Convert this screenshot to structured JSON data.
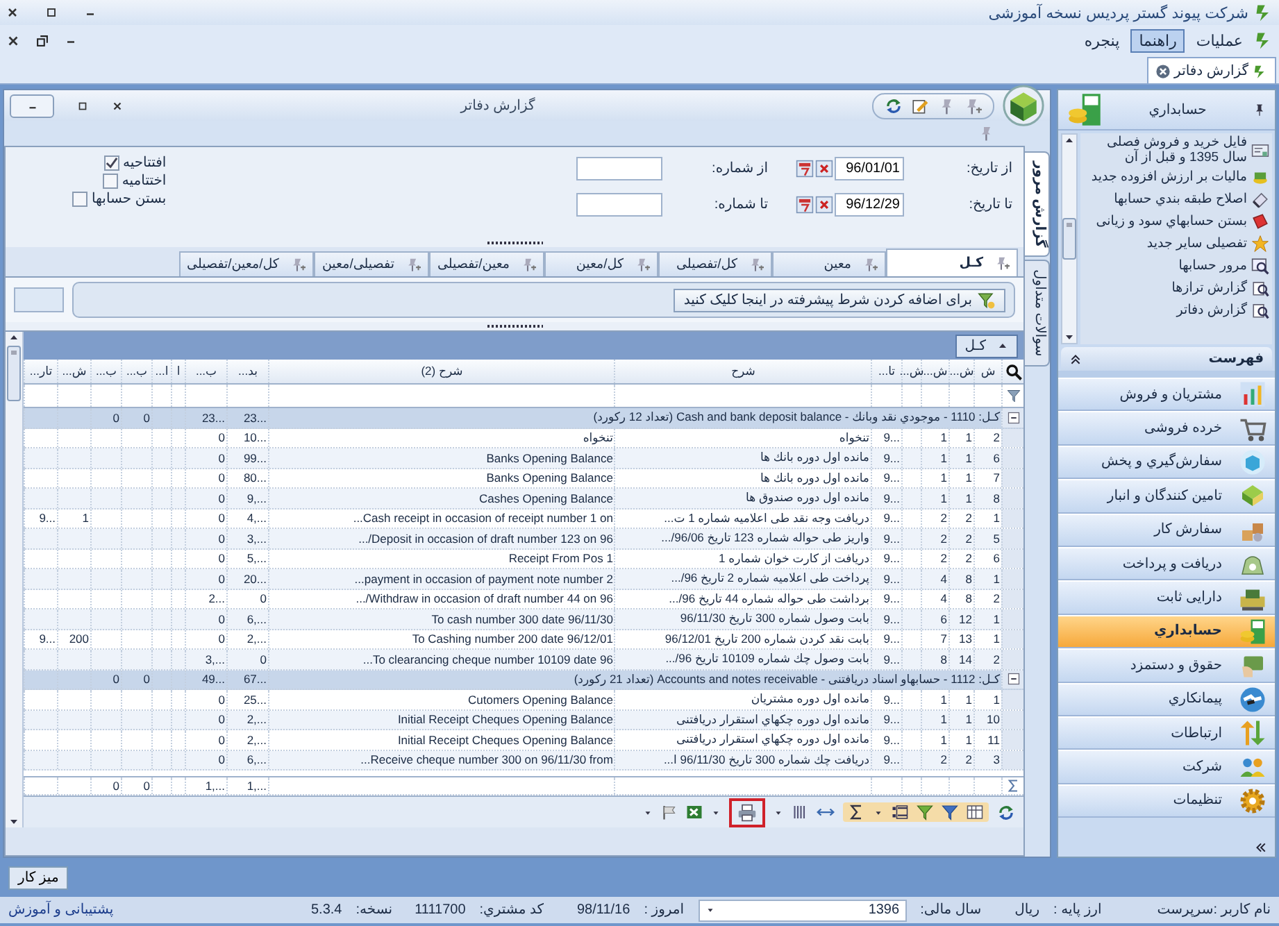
{
  "app": {
    "title": "شرکت پیوند گستر پردیس نسخه آموزشی"
  },
  "menu": [
    {
      "label": "عملیات",
      "selected": false
    },
    {
      "label": "راهنما",
      "selected": true
    },
    {
      "label": "پنجره",
      "selected": false
    }
  ],
  "doc_tabs": [
    {
      "label": "گزارش دفاتر",
      "selected": true
    }
  ],
  "report_window": {
    "title": "گزارش دفاتر",
    "side_tabs": [
      {
        "label": "گزارش مرور",
        "selected": true
      },
      {
        "label": "سوالات متداول",
        "selected": false
      }
    ],
    "date_filters": [
      {
        "label": "از تاریخ:",
        "value": "96/01/01"
      },
      {
        "label": "تا تاریخ:",
        "value": "96/12/29"
      }
    ],
    "number_filters": [
      {
        "label": "از شماره:"
      },
      {
        "label": "تا شماره:"
      }
    ],
    "options": [
      {
        "label": "افتتاحیه",
        "checked": true
      },
      {
        "label": "اختتامیه",
        "checked": false
      },
      {
        "label": "بستن حسابها",
        "checked": false
      }
    ],
    "level_tabs": [
      {
        "label": "کـل",
        "selected": true
      },
      {
        "label": "معین",
        "selected": false
      },
      {
        "label": "کل/تفصیلی",
        "selected": false
      },
      {
        "label": "کل/معین",
        "selected": false
      },
      {
        "label": "معین/تفصیلی",
        "selected": false
      },
      {
        "label": "تفصیلی/معین",
        "selected": false
      },
      {
        "label": "کل/معین/تفصیلی",
        "selected": false
      }
    ],
    "condition_hint": "برای اضافه کردن شرط پیشرفته در اینجا کلیک کنید",
    "group_by": "کـل",
    "grid": {
      "columns": [
        "ش",
        "ش...",
        "ش...",
        "ش...",
        "تا...",
        "شرح",
        "شرح (2)",
        "بد...",
        "ب...",
        "ا",
        "ا...",
        "ب...",
        "ب...",
        "ش...",
        "تار..."
      ],
      "groups": [
        {
          "label": "کـل:  1110 - موجودي نقد وبانك - Cash and bank deposit balance (تعداد 12 رکورد)",
          "expanded": true,
          "totals": {
            "column_8": "23...",
            "column_9": "23...",
            "column_12": "0",
            "column_13": "0"
          },
          "rows": [
            {
              "column_1": "2",
              "column_2": "1",
              "column_3": "1",
              "column_5": "9...",
              "column_6": "تنخواه",
              "column_7": "تنخواه",
              "column_8": "10...",
              "column_9": "0"
            },
            {
              "column_1": "6",
              "column_2": "1",
              "column_3": "1",
              "column_5": "9...",
              "column_6": "مانده اول دوره بانك ها",
              "column_7": "Banks  Opening Balance",
              "column_8": "99...",
              "column_9": "0"
            },
            {
              "column_1": "7",
              "column_2": "1",
              "column_3": "1",
              "column_5": "9...",
              "column_6": "مانده اول دوره بانك ها",
              "column_7": "Banks  Opening Balance",
              "column_8": "80...",
              "column_9": "0"
            },
            {
              "column_1": "8",
              "column_2": "1",
              "column_3": "1",
              "column_5": "9...",
              "column_6": "مانده اول دوره صندوق ها",
              "column_7": "Cashes  Opening Balance",
              "column_8": "9,...",
              "column_9": "0"
            },
            {
              "column_1": "1",
              "column_2": "2",
              "column_3": "2",
              "column_5": "9...",
              "column_6": "دریافت وجه نقد طی اعلامیه شماره 1 ت...",
              "column_7": "Cash receipt in occasion of receipt number 1 on...",
              "column_8": "4,...",
              "column_9": "0",
              "column_14": "1",
              "column_15": "9..."
            },
            {
              "column_1": "5",
              "column_2": "2",
              "column_3": "2",
              "column_5": "9...",
              "column_6": "واریز طی حواله شماره 123 تاریخ 96/06/...",
              "column_7": "Deposit in occasion of draft number 123 on 96/...",
              "column_8": "3,...",
              "column_9": "0"
            },
            {
              "column_1": "6",
              "column_2": "2",
              "column_3": "2",
              "column_5": "9...",
              "column_6": "دریافت از کارت خوان شماره 1",
              "column_7": "Receipt From Pos 1",
              "column_8": "5,...",
              "column_9": "0"
            },
            {
              "column_1": "1",
              "column_2": "8",
              "column_3": "4",
              "column_5": "9...",
              "column_6": "پرداخت طی اعلامیه شماره 2 تاریخ 96/...",
              "column_7": "payment in occasion of payment note number 2...",
              "column_8": "20...",
              "column_9": "0"
            },
            {
              "column_1": "2",
              "column_2": "8",
              "column_3": "4",
              "column_5": "9...",
              "column_6": "برداشت طی حواله شماره 44 تاریخ 96/...",
              "column_7": "Withdraw in occasion of draft number 44 on 96/...",
              "column_8": "0",
              "column_9": "2..."
            },
            {
              "column_1": "1",
              "column_2": "12",
              "column_3": "6",
              "column_5": "9...",
              "column_6": "بابت وصول شماره 300 تاریخ 96/11/30",
              "column_7": "To cash number 300 date 96/11/30",
              "column_8": "6,...",
              "column_9": "0"
            },
            {
              "column_1": "1",
              "column_2": "13",
              "column_3": "7",
              "column_5": "9...",
              "column_6": "بابت نقد کردن شماره 200 تاریخ 96/12/01",
              "column_7": "To Cashing number 200 date 96/12/01",
              "column_8": "2,...",
              "column_9": "0",
              "column_14": "200",
              "column_15": "9..."
            },
            {
              "column_1": "2",
              "column_2": "14",
              "column_3": "8",
              "column_5": "9...",
              "column_6": "بابت وصول چك شماره 10109 تاریخ 96/...",
              "column_7": "To clearancing cheque number 10109 date 96...",
              "column_8": "0",
              "column_9": "3,..."
            }
          ]
        },
        {
          "label": "کـل:  1112 - حسابهاو اسناد دریافتنی - Accounts and notes receivable (تعداد 21 رکورد)",
          "expanded": true,
          "totals": {
            "column_8": "67...",
            "column_9": "49...",
            "column_12": "0",
            "column_13": "0"
          },
          "rows": [
            {
              "column_1": "1",
              "column_2": "1",
              "column_3": "1",
              "column_5": "9...",
              "column_6": "مانده اول دوره مشتریان",
              "column_7": "Cutomers Opening Balance",
              "column_8": "25...",
              "column_9": "0"
            },
            {
              "column_1": "10",
              "column_2": "1",
              "column_3": "1",
              "column_5": "9...",
              "column_6": "مانده اول دوره چکهاي استقرار دریافتنی",
              "column_7": "Initial Receipt Cheques Opening Balance",
              "column_8": "2,...",
              "column_9": "0"
            },
            {
              "column_1": "11",
              "column_2": "1",
              "column_3": "1",
              "column_5": "9...",
              "column_6": "مانده اول دوره چکهاي استقرار دریافتنی",
              "column_7": "Initial Receipt Cheques Opening Balance",
              "column_8": "2,...",
              "column_9": "0"
            },
            {
              "column_1": "3",
              "column_2": "2",
              "column_3": "2",
              "column_5": "9...",
              "column_6": "دریافت چك شماره 300 تاریخ 96/11/30 ا...",
              "column_7": "Receive cheque number 300 on 96/11/30 from...",
              "column_8": "6,...",
              "column_9": "0"
            }
          ]
        }
      ],
      "summary": {
        "column_8": "1,...",
        "column_9": "1,...",
        "column_12": "0",
        "column_13": "0"
      }
    },
    "print_button": {
      "highlighted": true
    }
  },
  "sidebar": {
    "title": "حسابداري",
    "items": [
      "فایل خرید و فروش فصلی سال 1395 و قبل از آن",
      "مالیات بر ارزش افزوده جدید",
      "اصلاح طبقه بندي حسابها",
      "بستن حسابهاي سود و زیانی",
      "تفصیلی سایر جدید",
      "مرور حسابها",
      "گزارش ترازها",
      "گزارش دفاتر"
    ],
    "list_header": "فهرست",
    "modules": [
      {
        "label": "مشتریان و فروش",
        "selected": false
      },
      {
        "label": "خرده فروشی",
        "selected": false
      },
      {
        "label": "سفارش‌گیري و پخش",
        "selected": false
      },
      {
        "label": "تامین کنندگان و انبار",
        "selected": false
      },
      {
        "label": "سفارش کار",
        "selected": false
      },
      {
        "label": "دریافت و پرداخت",
        "selected": false
      },
      {
        "label": "دارایی ثابت",
        "selected": false
      },
      {
        "label": "حسابداري",
        "selected": true
      },
      {
        "label": "حقوق و دستمزد",
        "selected": false
      },
      {
        "label": "پیمانکاري",
        "selected": false
      },
      {
        "label": "ارتباطات",
        "selected": false
      },
      {
        "label": "شرکت",
        "selected": false
      },
      {
        "label": "تنظیمات",
        "selected": false
      }
    ]
  },
  "desk_button": "میز کار",
  "status": {
    "user": "نام کاربر :سرپرست",
    "base_currency_label": "ارز پایه :",
    "base_currency": "ریال",
    "fiscal_year_label": "سال مالی:",
    "fiscal_year": "1396",
    "today_label": "امروز :",
    "today": "98/11/16",
    "customer_code_label": "کد مشتري:",
    "customer_code": "1111700",
    "version_label": "نسخه:",
    "version": "5.3.4",
    "support_link": "پشتیبانی و آموزش"
  }
}
